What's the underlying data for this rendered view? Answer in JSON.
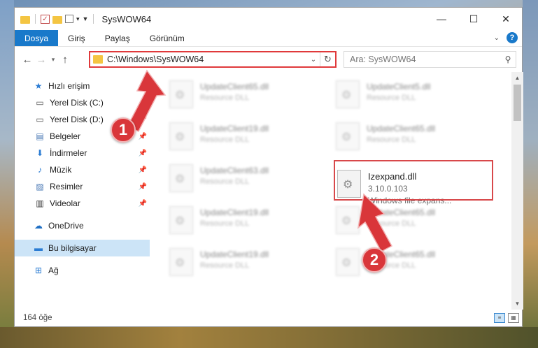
{
  "window": {
    "title": "SysWOW64",
    "controls": {
      "minimize": "—",
      "maximize": "☐",
      "close": "✕"
    }
  },
  "ribbon": {
    "tabs": [
      "Dosya",
      "Giriş",
      "Paylaş",
      "Görünüm"
    ],
    "help": "?"
  },
  "address": {
    "path": "C:\\Windows\\SysWOW64",
    "refresh": "↻"
  },
  "search": {
    "placeholder": "Ara: SysWOW64"
  },
  "nav": {
    "quick_access": "Hızlı erişim",
    "items": [
      {
        "label": "Yerel Disk (C:)",
        "icon": "drive-icon"
      },
      {
        "label": "Yerel Disk (D:)",
        "icon": "drive-icon"
      },
      {
        "label": "Belgeler",
        "icon": "documents-icon"
      },
      {
        "label": "İndirmeler",
        "icon": "download-icon"
      },
      {
        "label": "Müzik",
        "icon": "music-icon"
      },
      {
        "label": "Resimler",
        "icon": "pictures-icon"
      },
      {
        "label": "Videolar",
        "icon": "video-icon"
      }
    ],
    "onedrive": "OneDrive",
    "this_pc": "Bu bilgisayar",
    "network": "Ağ"
  },
  "files": [
    {
      "name": "UpdateClient65.dll",
      "desc": "Resource DLL"
    },
    {
      "name": "UpdateClient5.dll",
      "desc": "Resource DLL"
    },
    {
      "name": "UpdateClient19.dll",
      "desc": "Resource DLL"
    },
    {
      "name": "UpdateClient65.dll",
      "desc": "Resource DLL"
    },
    {
      "name": "UpdateClient63.dll",
      "desc": "Resource DLL"
    },
    {
      "name": "UpdateClient19.dll",
      "desc": "Resource DLL"
    },
    {
      "name": "UpdateClient65.dll",
      "desc": "Resource DLL"
    },
    {
      "name": "UpdateClient19.dll",
      "desc": "Resource DLL"
    },
    {
      "name": "UpdateClient65.dll",
      "desc": "Resource DLL"
    }
  ],
  "highlighted_file": {
    "name": "Izexpand.dll",
    "version": "3.10.0.103",
    "desc": "Windows file expans..."
  },
  "status": {
    "count": "164 öğe"
  },
  "annotations": {
    "step1": "1",
    "step2": "2",
    "color": "#d9363a"
  }
}
